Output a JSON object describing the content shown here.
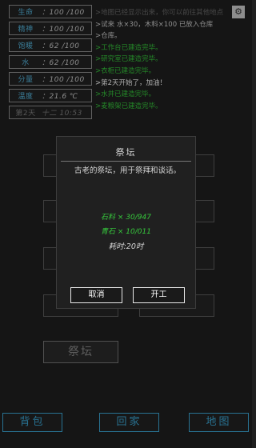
{
  "stats": [
    {
      "label": "生命",
      "value": "：100 /100"
    },
    {
      "label": "精神",
      "value": "：100 /100"
    },
    {
      "label": "饱暖",
      "value": "：62 /100"
    },
    {
      "label": "水",
      "value": "：62 /100"
    },
    {
      "label": "分量",
      "value": "：100 /100"
    },
    {
      "label": "温度",
      "value": "：21.6 ℃"
    },
    {
      "label": "第2天",
      "value": "十二 10:53"
    }
  ],
  "log": [
    {
      "text": ">地图已经显示出来，你可以前往其他地点",
      "style": "f"
    },
    {
      "text": ">试来 水×30，木料×100 已放入仓库",
      "style": "n"
    },
    {
      "text": ">仓库。",
      "style": "n"
    },
    {
      "text": ">工作台已建造完毕。",
      "style": "g"
    },
    {
      "text": ">研究室已建造完毕。",
      "style": "g"
    },
    {
      "text": ">衣柜已建造完毕。",
      "style": "g"
    },
    {
      "text": ">第2天开始了，加油！",
      "style": "w"
    },
    {
      "text": ">水井已建造完毕。",
      "style": "g"
    },
    {
      "text": ">麦粮架已建造完毕。",
      "style": "g"
    }
  ],
  "altar_label": "祭坛",
  "nav": {
    "craft": "背包",
    "home": "回家",
    "map": "地图"
  },
  "dialog": {
    "title": "祭坛",
    "description": "古老的祭坛，用于祭拜和谈话。",
    "requirements": [
      "石料 × 30/947",
      "青石 × 10/011"
    ],
    "time": "耗时:20时",
    "cancel": "取消",
    "confirm": "开工"
  },
  "colors": {
    "accent": "#3ba8d8",
    "success": "#36c83c"
  }
}
